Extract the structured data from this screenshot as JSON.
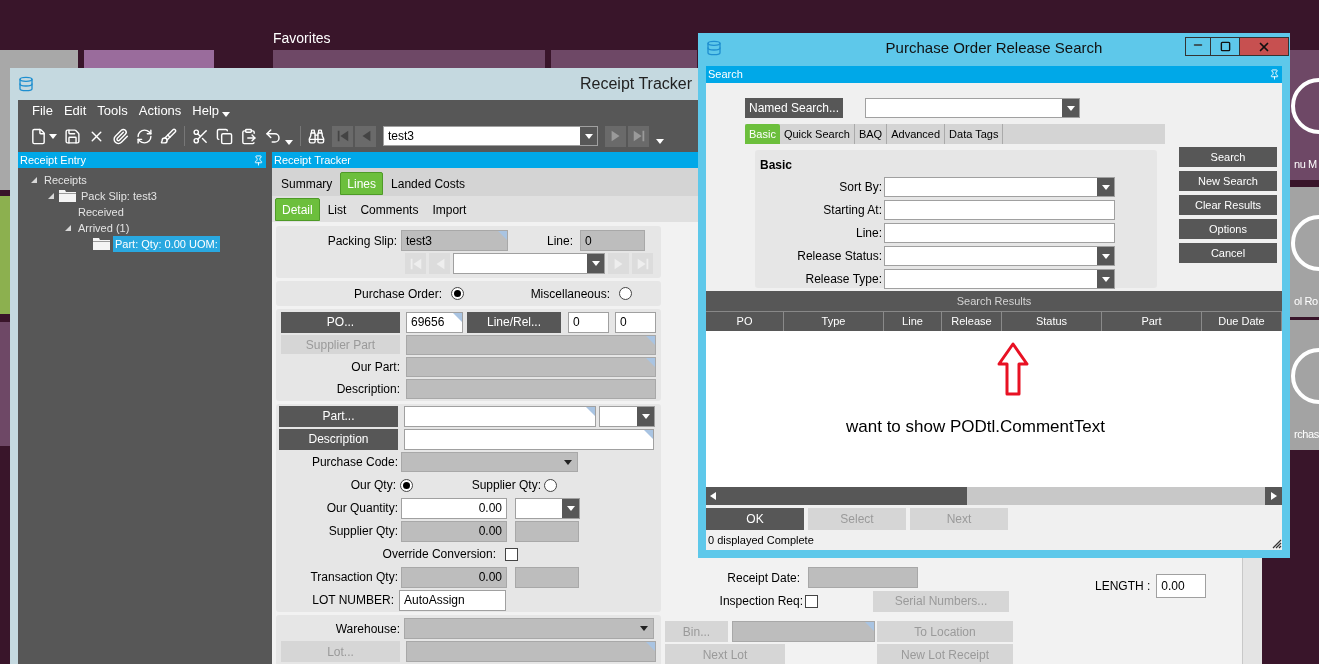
{
  "desktop": {
    "section_title": "Favorites",
    "tiles": [
      {
        "label": "nu M"
      },
      {
        "label": "ol Ro"
      },
      {
        "label": "rchas"
      }
    ]
  },
  "receipt_window": {
    "title": "Receipt Tracker",
    "menu": [
      "File",
      "Edit",
      "Tools",
      "Actions",
      "Help"
    ],
    "record_combo": {
      "value": "test3"
    },
    "tree_panel": {
      "title": "Receipt Entry",
      "tree": [
        {
          "label": "Receipts",
          "kind": "plain",
          "expanded": true,
          "selected": false,
          "children": [
            {
              "label": "Pack Slip: test3",
              "kind": "folder",
              "expanded": true,
              "selected": false,
              "children": [
                {
                  "label": "Received",
                  "kind": "plain",
                  "selected": false
                },
                {
                  "label": "Arrived (1)",
                  "kind": "plain",
                  "expanded": true,
                  "selected": false,
                  "children": [
                    {
                      "label": "Part: Qty: 0.00 UOM:",
                      "kind": "folder",
                      "selected": true
                    }
                  ]
                }
              ]
            }
          ]
        }
      ]
    },
    "main_panel": {
      "title": "Receipt Tracker",
      "tabs": [
        {
          "label": "Summary",
          "selected": false
        },
        {
          "label": "Lines",
          "selected": true
        },
        {
          "label": "Landed Costs",
          "selected": false
        }
      ],
      "subtabs": [
        {
          "label": "Detail",
          "selected": true
        },
        {
          "label": "List",
          "selected": false
        },
        {
          "label": "Comments",
          "selected": false
        },
        {
          "label": "Import",
          "selected": false
        }
      ]
    },
    "form": {
      "packing_slip": {
        "label": "Packing Slip:",
        "value": "test3"
      },
      "line": {
        "label": "Line:",
        "value": "0"
      },
      "source": [
        {
          "label": "Purchase Order:",
          "selected": true
        },
        {
          "label": "Miscellaneous:",
          "selected": false
        }
      ],
      "po_button": {
        "label": "PO...",
        "disabled": false
      },
      "po_value": "69656",
      "line_rel_button": {
        "label": "Line/Rel...",
        "disabled": false
      },
      "line_value": "0",
      "release_value": "0",
      "supplier_part_button": {
        "label": "Supplier Part",
        "disabled": true
      },
      "our_part_label": "Our Part:",
      "description_label": "Description:",
      "part_button": {
        "label": "Part...",
        "disabled": false
      },
      "description_button": {
        "label": "Description",
        "disabled": false
      },
      "purchase_code_label": "Purchase Code:",
      "qty_mode": [
        {
          "label": "Our Qty:",
          "selected": true
        },
        {
          "label": "Supplier Qty:",
          "selected": false
        }
      ],
      "our_quantity": {
        "label": "Our Quantity:",
        "value": "0.00"
      },
      "supplier_qty": {
        "label": "Supplier Qty:",
        "value": "0.00"
      },
      "override_conversion": {
        "label": "Override Conversion:",
        "checked": false
      },
      "transaction_qty": {
        "label": "Transaction Qty:",
        "value": "0.00"
      },
      "lot_number": {
        "label": "LOT NUMBER:",
        "value": "AutoAssign"
      },
      "warehouse_label": "Warehouse:",
      "lot_button": {
        "label": "Lot...",
        "disabled": true
      },
      "receipt_date_label": "Receipt Date:",
      "inspection_req": {
        "label": "Inspection Req:",
        "checked": false
      },
      "serial_numbers_button": {
        "label": "Serial Numbers...",
        "disabled": true
      },
      "bin_button": {
        "label": "Bin...",
        "disabled": true
      },
      "to_location_button": {
        "label": "To Location",
        "disabled": true
      },
      "next_lot_button": {
        "label": "Next Lot",
        "disabled": true
      },
      "new_lot_receipt_button": {
        "label": "New Lot Receipt",
        "disabled": true
      },
      "length": {
        "label": "LENGTH :",
        "value": "0.00"
      }
    }
  },
  "search_dialog": {
    "title": "Purchase Order Release Search",
    "panel_title": "Search",
    "named_search_button": "Named Search...",
    "tabs": [
      {
        "label": "Basic",
        "selected": true
      },
      {
        "label": "Quick Search",
        "selected": false
      },
      {
        "label": "BAQ",
        "selected": false
      },
      {
        "label": "Advanced",
        "selected": false
      },
      {
        "label": "Data Tags",
        "selected": false
      }
    ],
    "group_title": "Basic",
    "fields": [
      {
        "label": "Sort By:",
        "kind": "dropdown"
      },
      {
        "label": "Starting At:",
        "kind": "text"
      },
      {
        "label": "Line:",
        "kind": "text"
      },
      {
        "label": "Release Status:",
        "kind": "dropdown"
      },
      {
        "label": "Release Type:",
        "kind": "dropdown"
      }
    ],
    "side_buttons": [
      "Search",
      "New Search",
      "Clear Results",
      "Options",
      "Cancel"
    ],
    "results_title": "Search Results",
    "columns": [
      "PO",
      "Type",
      "Line",
      "Release",
      "Status",
      "Part",
      "Due Date"
    ],
    "annotation": "want to show PODtl.CommentText",
    "bottom_buttons": [
      {
        "label": "OK",
        "disabled": false
      },
      {
        "label": "Select",
        "disabled": true
      },
      {
        "label": "Next",
        "disabled": true
      }
    ],
    "status": "0 displayed Complete"
  }
}
